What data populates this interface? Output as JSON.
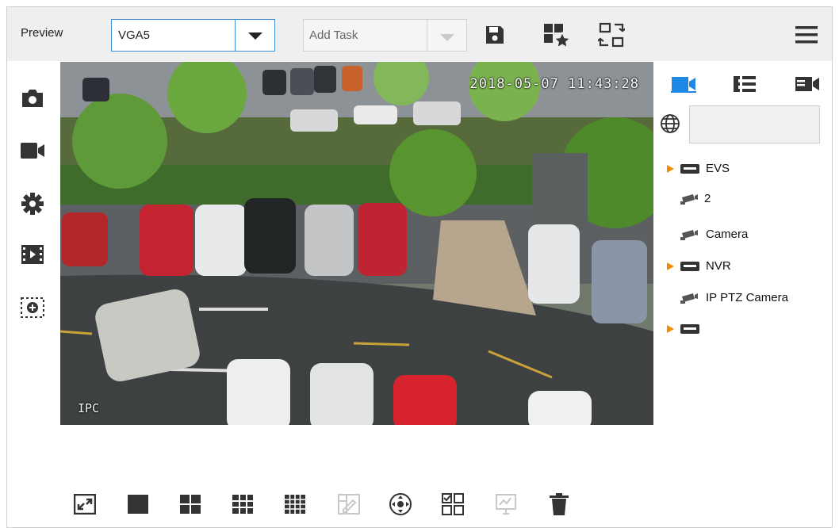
{
  "header": {
    "title": "Preview",
    "display_select": "VGA5",
    "task_select": "Add Task",
    "icons": [
      "save-icon",
      "favorite-layout-icon",
      "layout-switch-icon",
      "menu-icon"
    ]
  },
  "left_tools": [
    "snapshot-icon",
    "record-icon",
    "settings-icon",
    "playback-icon",
    "digital-zoom-icon"
  ],
  "video": {
    "timestamp": "2018-05-07 11:43:28",
    "channel_name": "IPC"
  },
  "right_panel": {
    "tabs": [
      "camera-tab-icon",
      "list-tab-icon",
      "video-tab-icon"
    ],
    "active_tab": 0,
    "tree": [
      {
        "type": "device",
        "label": "EVS",
        "expandable": true
      },
      {
        "type": "camera",
        "label": "2"
      },
      {
        "type": "camera",
        "label": "Camera"
      },
      {
        "type": "device",
        "label": "NVR",
        "expandable": true
      },
      {
        "type": "camera",
        "label": "IP PTZ Camera"
      },
      {
        "type": "device",
        "label": "",
        "expandable": true
      }
    ]
  },
  "bottom_bar": [
    "fullscreen-icon",
    "layout-1-icon",
    "layout-4-icon",
    "layout-9-icon",
    "layout-16-icon",
    "custom-layout-icon",
    "ptz-icon",
    "window-select-icon",
    "monitor-icon",
    "delete-icon"
  ],
  "colors": {
    "accent": "#1e88e5",
    "tree_arrow": "#f08c00",
    "topbar_bg": "#efefef"
  }
}
